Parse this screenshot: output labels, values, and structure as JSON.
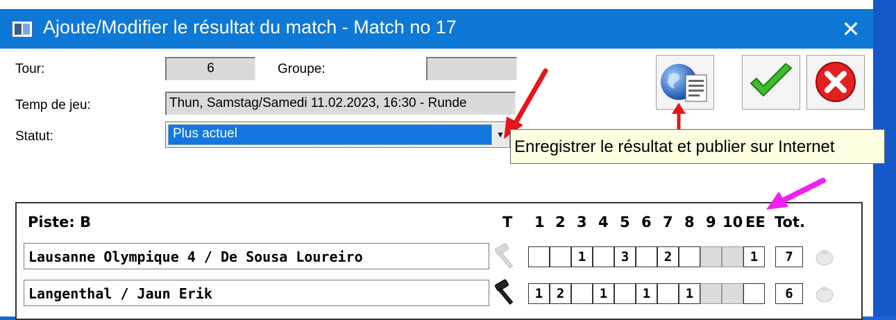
{
  "window": {
    "title": "Ajoute/Modifier le résultat du match - Match no 17",
    "close_glyph": "✕"
  },
  "form": {
    "tour_label": "Tour:",
    "tour_value": "6",
    "groupe_label": "Groupe:",
    "groupe_value": "",
    "temps_label": "Temp de jeu:",
    "temps_value": "Thun, Samstag/Samedi 11.02.2023, 16:30 - Runde",
    "statut_label": "Statut:",
    "statut_value": "Plus actuel"
  },
  "toolbar": {
    "publish_icon": "globe-document-icon",
    "confirm_icon": "green-checkmark-icon",
    "cancel_icon": "red-x-icon"
  },
  "tooltip": {
    "text": "Enregistrer le résultat et publier sur Internet"
  },
  "scoreboard": {
    "piste_label": "Piste: B",
    "headers": [
      "T",
      "1",
      "2",
      "3",
      "4",
      "5",
      "6",
      "7",
      "8",
      "9",
      "10",
      "EE",
      "Tot."
    ],
    "rows": [
      {
        "team": "Lausanne Olympique 4 / De Sousa Loureiro",
        "hammer": "inactive",
        "ends": [
          "",
          "",
          "1",
          "",
          "3",
          "",
          "2",
          "",
          "",
          "",
          "1"
        ],
        "total": "7"
      },
      {
        "team": "Langenthal / Jaun Erik",
        "hammer": "active",
        "ends": [
          "1",
          "2",
          "",
          "1",
          "",
          "1",
          "",
          "1",
          "",
          "",
          ""
        ],
        "total": "6"
      }
    ]
  },
  "annotations": {
    "arrow_red": "#e8141b",
    "arrow_magenta": "#ee22ee"
  }
}
